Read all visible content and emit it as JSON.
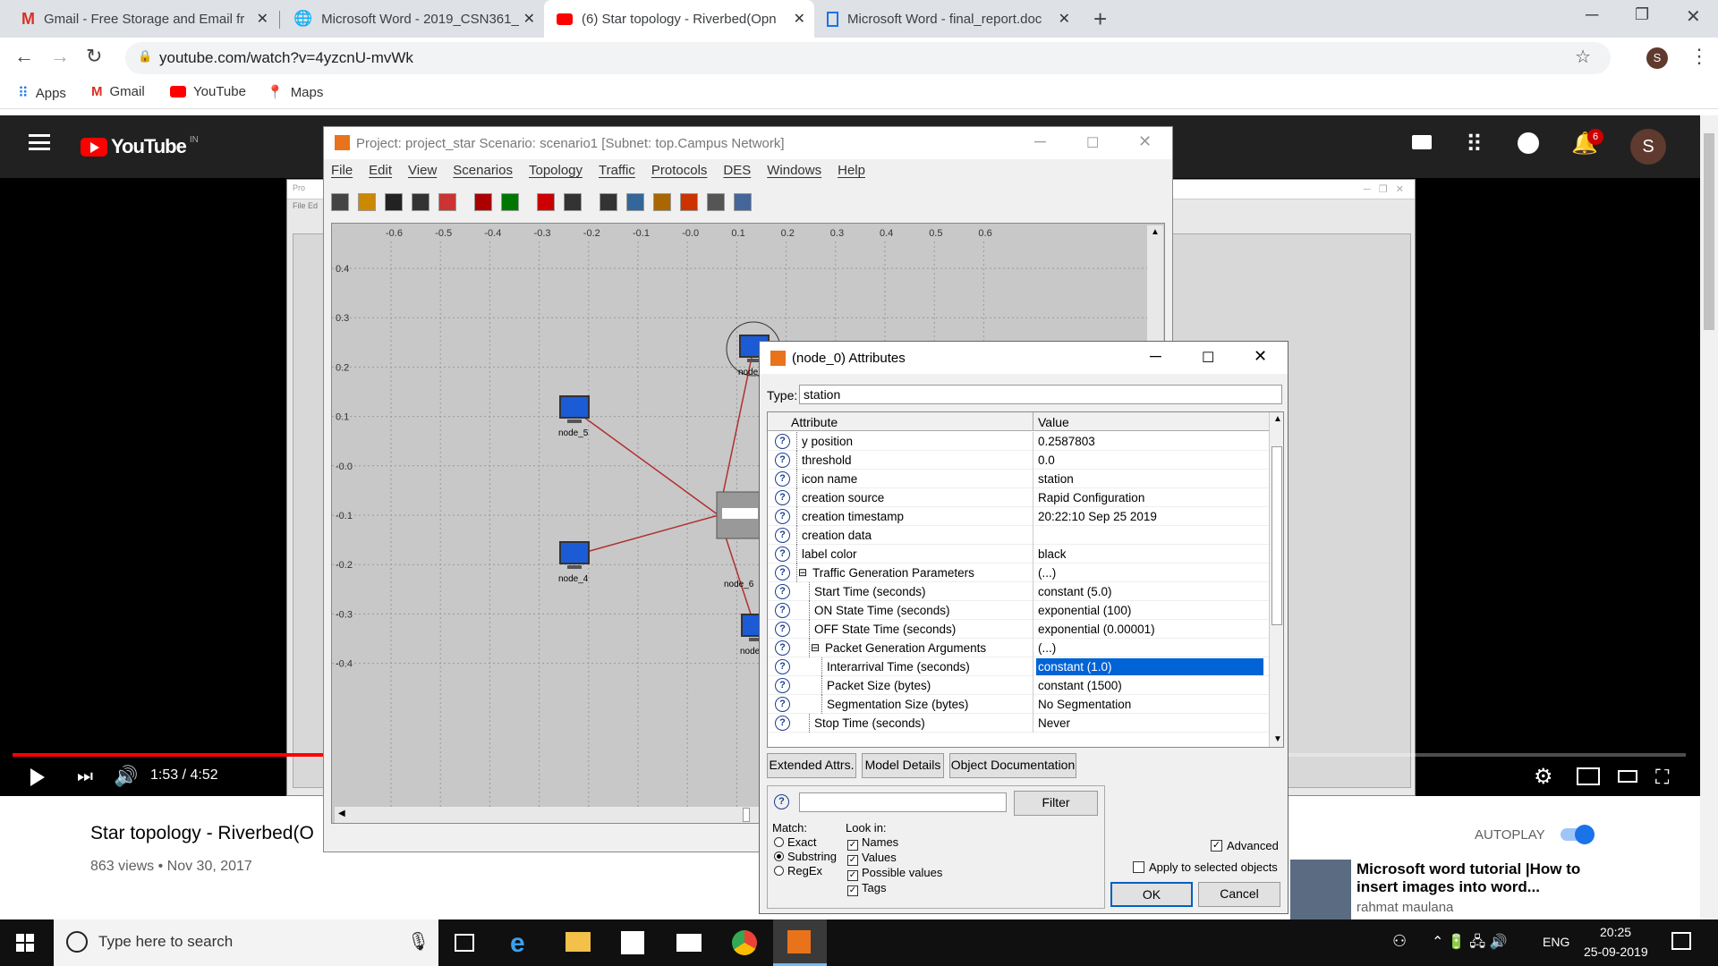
{
  "browser": {
    "tabs": [
      {
        "title": "Gmail - Free Storage and Email fr",
        "favicon": "gmail-icon",
        "color": "#d93025"
      },
      {
        "title": "Microsoft Word - 2019_CSN361_",
        "favicon": "globe-icon",
        "color": "#555555"
      },
      {
        "title": "(6) Star topology - Riverbed(Opn",
        "favicon": "youtube-icon",
        "color": "#ff0000"
      },
      {
        "title": "Microsoft Word - final_report.doc",
        "favicon": "document-icon",
        "color": "#1a73e8"
      }
    ],
    "url": "youtube.com/watch?v=4yzcnU-mvWk",
    "profile_initial": "S",
    "bookmarks": [
      "Apps",
      "Gmail",
      "YouTube",
      "Maps"
    ]
  },
  "youtube": {
    "logo": "YouTube",
    "region": "IN",
    "notifications": "6",
    "avatar": "S",
    "time": "1:53 / 4:52",
    "progress": 0.39,
    "video_title": "Star topology - Riverbed(O",
    "meta": "863 views • Nov 30, 2017",
    "autoplay_label": "AUTOPLAY",
    "rec_title": "Microsoft word tutorial |How to insert images into word...",
    "rec_channel": "rahmat maulana"
  },
  "riverbed": {
    "title": "Project: project_star Scenario: scenario1  [Subnet: top.Campus Network]",
    "menu": [
      "File",
      "Edit",
      "View",
      "Scenarios",
      "Topology",
      "Traffic",
      "Protocols",
      "DES",
      "Windows",
      "Help"
    ],
    "x_ticks": [
      "-0.6",
      "-0.5",
      "-0.4",
      "-0.3",
      "-0.2",
      "-0.1",
      "-0.0",
      "0.1",
      "0.2",
      "0.3",
      "0.4",
      "0.5",
      "0.6"
    ],
    "y_ticks": [
      "0.4",
      "0.3",
      "0.2",
      "0.1",
      "-0.0",
      "-0.1",
      "-0.2",
      "-0.3",
      "-0.4"
    ],
    "nodes": [
      "node_0",
      "node_5",
      "node_4",
      "node_6",
      "node_3"
    ],
    "bg_window": {
      "file": "File",
      "edit": "Ed"
    }
  },
  "dialog": {
    "title": "(node_0) Attributes",
    "type_label": "Type:",
    "type_value": "station",
    "col_attr": "Attribute",
    "col_value": "Value",
    "rows": [
      {
        "name": "y position",
        "value": "0.2587803",
        "level": 0
      },
      {
        "name": "threshold",
        "value": "0.0",
        "level": 0
      },
      {
        "name": "icon name",
        "value": "station",
        "level": 0
      },
      {
        "name": "creation source",
        "value": "Rapid Configuration",
        "level": 0
      },
      {
        "name": "creation timestamp",
        "value": "20:22:10 Sep 25 2019",
        "level": 0
      },
      {
        "name": "creation data",
        "value": "",
        "level": 0
      },
      {
        "name": "label color",
        "value": "black",
        "level": 0
      },
      {
        "name": "Traffic Generation Parameters",
        "value": "(...)",
        "level": 0,
        "expand": "⊟"
      },
      {
        "name": "Start Time (seconds)",
        "value": "constant (5.0)",
        "level": 1
      },
      {
        "name": "ON State Time (seconds)",
        "value": "exponential (100)",
        "level": 1
      },
      {
        "name": "OFF State Time (seconds)",
        "value": "exponential (0.00001)",
        "level": 1
      },
      {
        "name": "Packet Generation Arguments",
        "value": "(...)",
        "level": 1,
        "expand": "⊟"
      },
      {
        "name": "Interarrival Time (seconds)",
        "value": "constant (1.0)",
        "level": 2,
        "selected": true
      },
      {
        "name": "Packet Size (bytes)",
        "value": "constant (1500)",
        "level": 2
      },
      {
        "name": "Segmentation Size (bytes)",
        "value": "No Segmentation",
        "level": 2
      },
      {
        "name": "Stop Time (seconds)",
        "value": "Never",
        "level": 1
      }
    ],
    "buttons": {
      "extended": "Extended Attrs.",
      "model": "Model Details",
      "docs": "Object Documentation",
      "filter": "Filter",
      "ok": "OK",
      "cancel": "Cancel"
    },
    "match_label": "Match:",
    "match_opts": [
      "Exact",
      "Substring",
      "RegEx"
    ],
    "match_selected": "Substring",
    "lookin_label": "Look in:",
    "lookin_opts": [
      "Names",
      "Values",
      "Possible values",
      "Tags"
    ],
    "advanced": "Advanced",
    "apply_selected": "Apply to selected objects"
  },
  "taskbar": {
    "search_placeholder": "Type here to search",
    "lang": "ENG",
    "time": "20:25",
    "date": "25-09-2019"
  }
}
